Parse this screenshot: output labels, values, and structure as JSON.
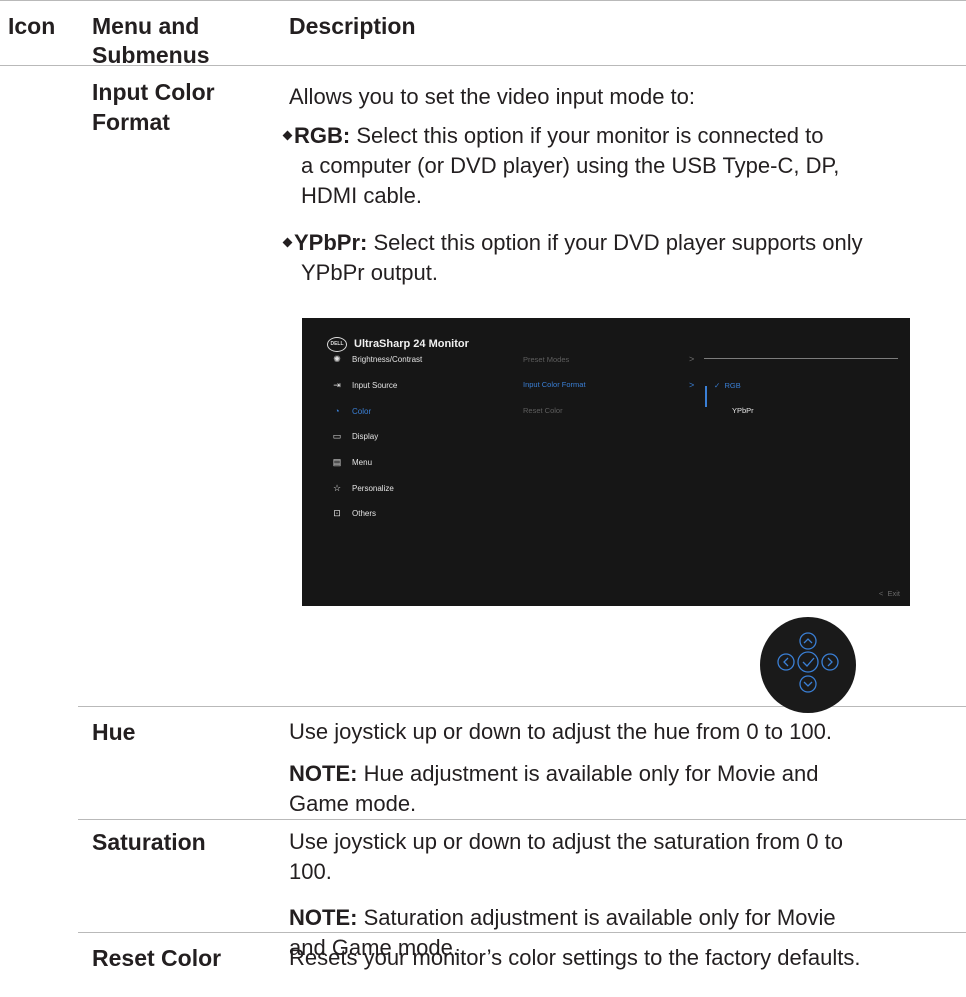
{
  "header": {
    "icon": "Icon",
    "menu_line1": "Menu and",
    "menu_line2": "Submenus",
    "description": "Description"
  },
  "input_color_format": {
    "name_line1": "Input Color",
    "name_line2": "Format",
    "intro": "Allows you to set the video input mode to:",
    "rgb_lead": "RGB:",
    "rgb_line1": " Select this option if your monitor is connected to",
    "rgb_line2": "a computer (or DVD player) using the USB Type-C, DP,",
    "rgb_line3": "HDMI cable.",
    "ypbpr_lead": "YPbPr:",
    "ypbpr_line1": " Select this option if your DVD player supports only",
    "ypbpr_line2": "YPbPr output."
  },
  "osd": {
    "logo": "DELL",
    "title": "UltraSharp 24 Monitor",
    "menu": [
      {
        "label": "Brightness/Contrast",
        "icon": "brightness-icon"
      },
      {
        "label": "Input Source",
        "icon": "input-source-icon"
      },
      {
        "label": "Color",
        "icon": "color-icon"
      },
      {
        "label": "Display",
        "icon": "display-icon"
      },
      {
        "label": "Menu",
        "icon": "menu-icon"
      },
      {
        "label": "Personalize",
        "icon": "star-icon"
      },
      {
        "label": "Others",
        "icon": "others-icon"
      }
    ],
    "submenu": [
      "Preset Modes",
      "Input Color Format",
      "Reset Color"
    ],
    "options": [
      "RGB",
      "YPbPr"
    ],
    "exit": "Exit",
    "colors": {
      "background": "#161616",
      "accent": "#3a7fd5"
    }
  },
  "hue": {
    "name": "Hue",
    "desc": "Use joystick up or down to adjust the hue from 0 to 100.",
    "note_lead": "NOTE:",
    "note_line1": " Hue adjustment is available only for Movie and",
    "note_line2": "Game mode."
  },
  "saturation": {
    "name": "Saturation",
    "desc_line1": "Use joystick up or down to adjust the saturation from 0 to",
    "desc_line2": "100.",
    "note_lead": "NOTE:",
    "note_line1": " Saturation adjustment is available only for Movie",
    "note_line2": "and Game mode."
  },
  "reset_color": {
    "name": "Reset Color",
    "desc": "Resets your monitor’s color settings to the factory defaults."
  }
}
